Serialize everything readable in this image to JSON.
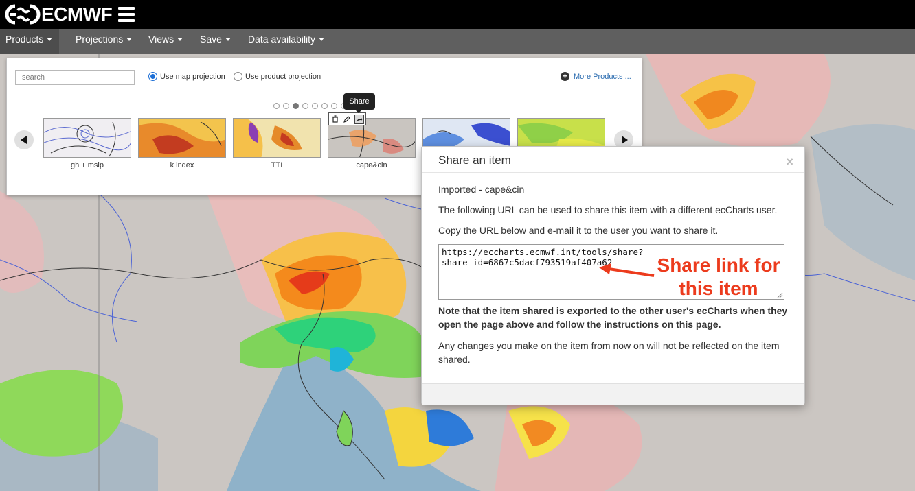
{
  "header": {
    "logo_text": "ECMWF"
  },
  "menu": {
    "items": [
      {
        "label": "Products"
      },
      {
        "label": "Projections"
      },
      {
        "label": "Views"
      },
      {
        "label": "Save"
      },
      {
        "label": "Data availability"
      }
    ]
  },
  "products_panel": {
    "search_placeholder": "search",
    "projection_options": [
      {
        "label": "Use map projection",
        "selected": true
      },
      {
        "label": "Use product projection",
        "selected": false
      }
    ],
    "more_products_label": "More Products ...",
    "page_dots": 8,
    "active_page": 3,
    "thumbnails": [
      {
        "label": "gh + mslp"
      },
      {
        "label": "k index"
      },
      {
        "label": "TTI"
      },
      {
        "label": "cape&cin"
      },
      {
        "label": ""
      },
      {
        "label": ""
      }
    ],
    "tooltip": "Share"
  },
  "modal": {
    "title": "Share an item",
    "close_glyph": "×",
    "item_name": "Imported - cape&cin",
    "intro": "The following URL can be used to share this item with a different ecCharts user.",
    "instruction": "Copy the URL below and e-mail it to the user you want to share it.",
    "url_line1": "https://eccharts.ecmwf.int/tools/share?",
    "url_line2": "share_id=6867c5dacf793519af407a62",
    "note": "Note that the item shared is exported to the other user's ecCharts when they open the page above and follow the instructions on this page.",
    "changes_note": "Any changes you make on the item from now on will not be reflected on the item shared."
  },
  "annotation": {
    "line1": "Share link for",
    "line2": "this item",
    "color": "#ec3b1d"
  },
  "colors": {
    "header_bg": "#000000",
    "menubar_bg": "#5f5f5f",
    "link_blue": "#2b6cb0"
  }
}
